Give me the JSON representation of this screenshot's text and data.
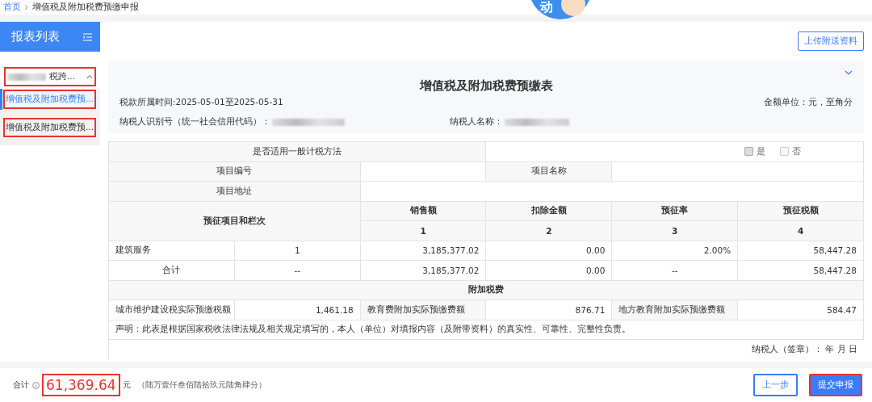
{
  "breadcrumb": [
    {
      "label": "首页",
      "link": true
    },
    {
      "label": "增值税及附加税费预缴申报",
      "link": false
    }
  ],
  "mascot": {
    "text": "动"
  },
  "sidebar": {
    "title": "报表列表",
    "groups": [
      {
        "label": "税跨...",
        "expanded": true,
        "highlighted": true,
        "children": [
          {
            "label": "增值税及附加税费预...",
            "selected": true,
            "highlighted": true
          },
          {
            "label": "增值税及附加税费预...",
            "selected": false,
            "highlighted": true
          }
        ]
      }
    ]
  },
  "upload_button": "上传附送资料",
  "form": {
    "title": "增值税及附加税费预缴表",
    "period": "税款所属时间:2025-05-01至2025-05-31",
    "unit": "金额单位：元，至角分",
    "taxpayer_id_label": "纳税人识别号（统一社会信用代码）：",
    "taxpayer_name_label": "纳税人名称："
  },
  "table": {
    "rows": [
      {
        "kind": "method",
        "label": "是否适用一般计税方法",
        "options": [
          {
            "label": "是",
            "checked": true
          },
          {
            "label": "否",
            "checked": false
          }
        ]
      },
      {
        "kind": "project",
        "number_label": "项目编号",
        "name_label": "项目名称"
      },
      {
        "kind": "address",
        "label": "项目地址"
      },
      {
        "kind": "header",
        "label": "预征项目和栏次",
        "columns": [
          "销售额",
          "扣除金额",
          "预征率",
          "预征税额"
        ],
        "numbers": [
          "1",
          "2",
          "3",
          "4"
        ]
      },
      {
        "kind": "item",
        "cells": [
          "建筑服务",
          "1",
          "3,185,377.02",
          "0.00",
          "2.00%",
          "58,447.28"
        ]
      },
      {
        "kind": "total",
        "cells": [
          "合计",
          "--",
          "3,185,377.02",
          "0.00",
          "--",
          "58,447.28"
        ]
      },
      {
        "kind": "section",
        "label": "附加税费"
      },
      {
        "kind": "surtax",
        "cells": [
          "城市维护建设税实际预缴税额",
          "1,461.18",
          "教育费附加实际预缴费额",
          "876.71",
          "地方教育附加实际预缴费额",
          "584.47"
        ]
      },
      {
        "kind": "statement",
        "text": "声明：此表是根据国家税收法律法规及相关规定填写的，本人（单位）对填报内容（及附带资料）的真实性、可靠性、完整性负责。"
      },
      {
        "kind": "signature",
        "text": "纳税人（签章）：          年   月   日"
      }
    ]
  },
  "footer": {
    "label": "合计",
    "amount": "61,369.64",
    "amount_highlighted": true,
    "currency": "元",
    "amount_words": "（陆万壹仟叁佰陆拾玖元陆角肆分）",
    "buttons": [
      {
        "label": "上一步",
        "kind": "secondary",
        "highlighted": false
      },
      {
        "label": "提交申报",
        "kind": "primary",
        "highlighted": true
      }
    ]
  }
}
